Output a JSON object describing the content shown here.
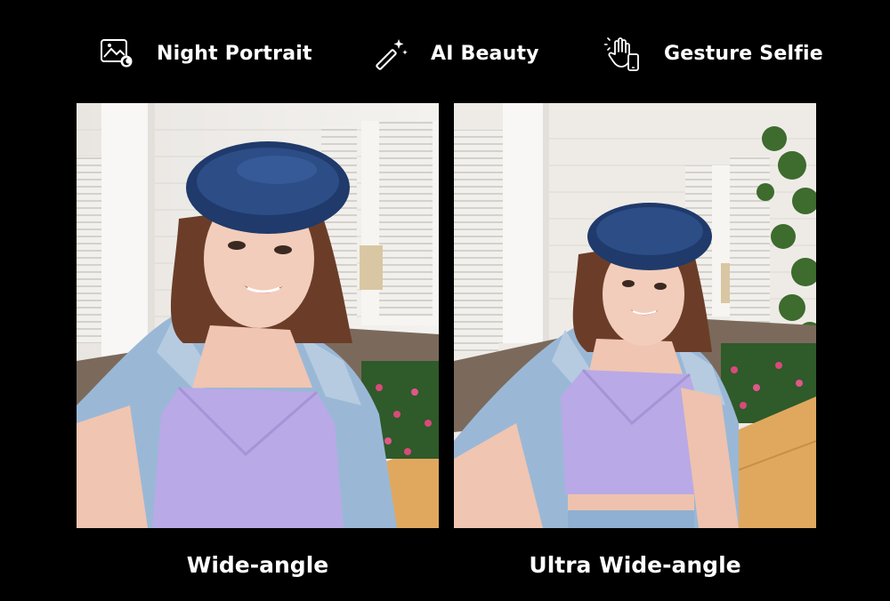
{
  "features": [
    {
      "icon": "night-portrait-icon",
      "label": "Night Portrait"
    },
    {
      "icon": "magic-wand-icon",
      "label": "AI Beauty"
    },
    {
      "icon": "gesture-hand-icon",
      "label": "Gesture Selfie"
    }
  ],
  "photos": [
    {
      "caption": "Wide-angle"
    },
    {
      "caption": "Ultra Wide-angle"
    }
  ],
  "colors": {
    "background": "#000000",
    "text": "#ffffff",
    "beret": "#1f3a6b",
    "jacket": "#9ab8d6",
    "top": "#b9a9e6"
  }
}
